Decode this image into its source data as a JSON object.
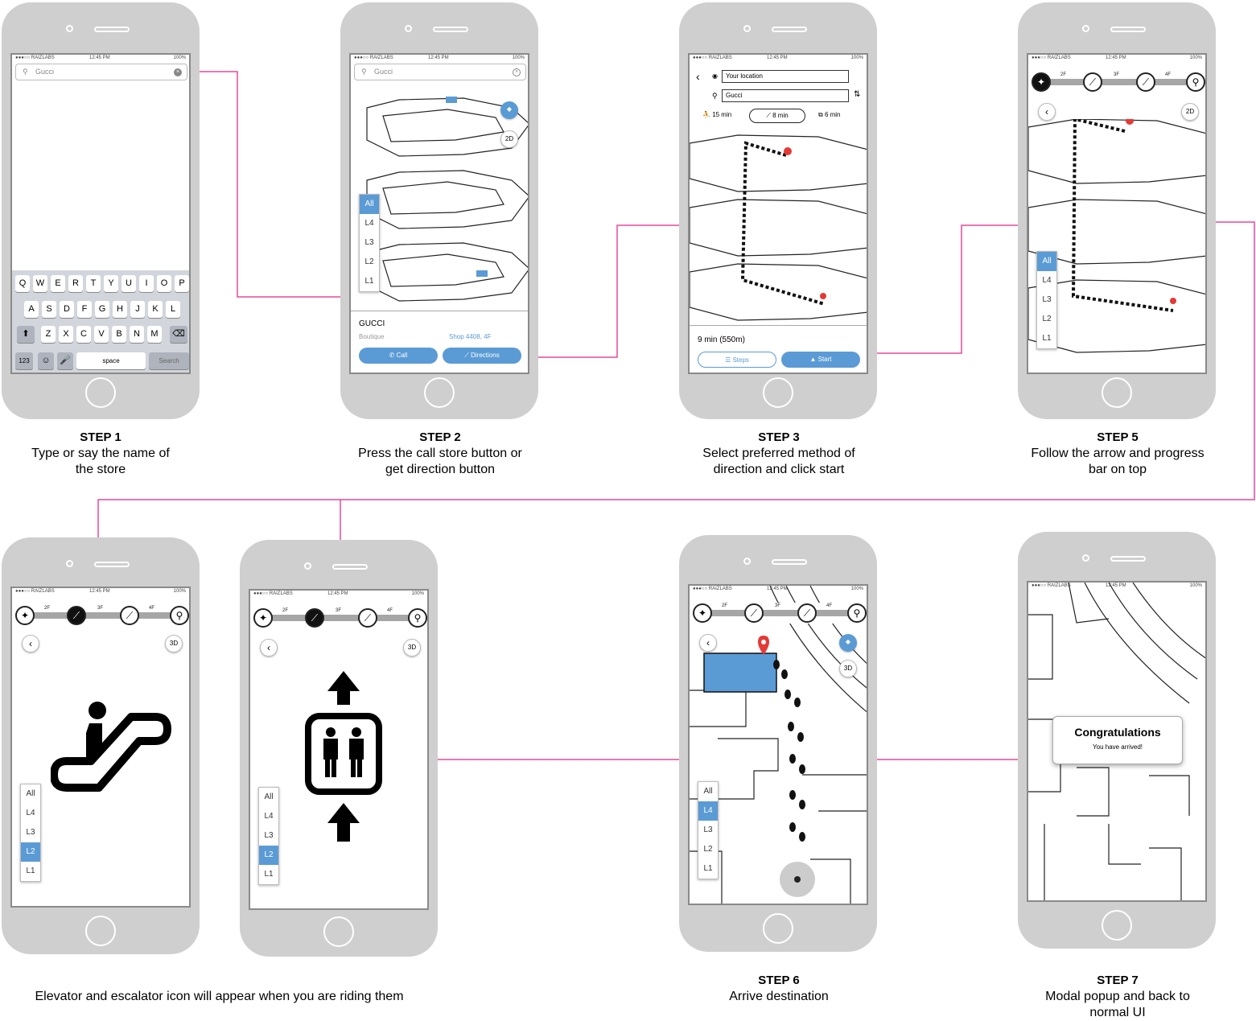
{
  "accent_color": "#e8489a",
  "brand_color": "#5b9bd5",
  "status_bar": {
    "carrier": "●●●○○ RAIZLABS",
    "time": "12:45 PM",
    "battery": "100%"
  },
  "screen1": {
    "search_value": "Gucci",
    "keyboard": {
      "row1": [
        "Q",
        "W",
        "E",
        "R",
        "T",
        "Y",
        "U",
        "I",
        "O",
        "P"
      ],
      "row2": [
        "A",
        "S",
        "D",
        "F",
        "G",
        "H",
        "J",
        "K",
        "L"
      ],
      "row3": [
        "Z",
        "X",
        "C",
        "V",
        "B",
        "N",
        "M"
      ],
      "key_123": "123",
      "space": "space",
      "search": "Search"
    }
  },
  "screen2": {
    "search_value": "Gucci",
    "map_mode": "2D",
    "levels": [
      "All",
      "L4",
      "L3",
      "L2",
      "L1"
    ],
    "selected_level": "All",
    "store_name": "GUCCI",
    "store_type": "Boutique",
    "store_location": "Shop 4408, 4F",
    "call_label": "Call",
    "directions_label": "Directions"
  },
  "screen3": {
    "from": "Your location",
    "to": "Gucci",
    "modes": [
      {
        "icon": "stairs-icon",
        "label": "15 min"
      },
      {
        "icon": "escalator-icon",
        "label": "8 min"
      },
      {
        "icon": "elevator-icon",
        "label": "6 min"
      }
    ],
    "selected_mode": "8 min",
    "summary": "9 min (550m)",
    "steps_label": "Steps",
    "start_label": "Start"
  },
  "screen5": {
    "floors": [
      "2F",
      "3F",
      "4F"
    ],
    "map_mode": "2D",
    "levels": [
      "All",
      "L4",
      "L3",
      "L2",
      "L1"
    ],
    "selected_level": "All"
  },
  "screen6a": {
    "floors": [
      "2F",
      "3F",
      "4F"
    ],
    "map_mode": "3D",
    "levels": [
      "All",
      "L4",
      "L3",
      "L2",
      "L1"
    ],
    "selected_level": "L2"
  },
  "screen6b": {
    "floors": [
      "2F",
      "3F",
      "4F"
    ],
    "map_mode": "3D",
    "levels": [
      "All",
      "L4",
      "L3",
      "L2",
      "L1"
    ],
    "selected_level": "L2"
  },
  "screen7": {
    "floors": [
      "2F",
      "3F",
      "4F"
    ],
    "map_mode": "3D",
    "levels": [
      "All",
      "L4",
      "L3",
      "L2",
      "L1"
    ],
    "selected_level": "L4"
  },
  "screen8": {
    "modal_title": "Congratulations",
    "modal_text": "You have arrived!"
  },
  "captions": {
    "step1": {
      "title": "STEP 1",
      "text1": "Type or say the name of",
      "text2": "the store"
    },
    "step2": {
      "title": "STEP 2",
      "text1": "Press the call store button or",
      "text2": "get direction button"
    },
    "step3": {
      "title": "STEP 3",
      "text1": "Select preferred method of",
      "text2": "direction and click start"
    },
    "step5": {
      "title": "STEP 5",
      "text1": "Follow the arrow and progress",
      "text2": "bar on top"
    },
    "riding": {
      "text1": "Elevator and escalator icon will appear when you are riding them"
    },
    "step6": {
      "title": "STEP 6",
      "text1": "Arrive destination"
    },
    "step7": {
      "title": "STEP 7",
      "text1": "Modal popup and back to",
      "text2": "normal UI"
    }
  }
}
